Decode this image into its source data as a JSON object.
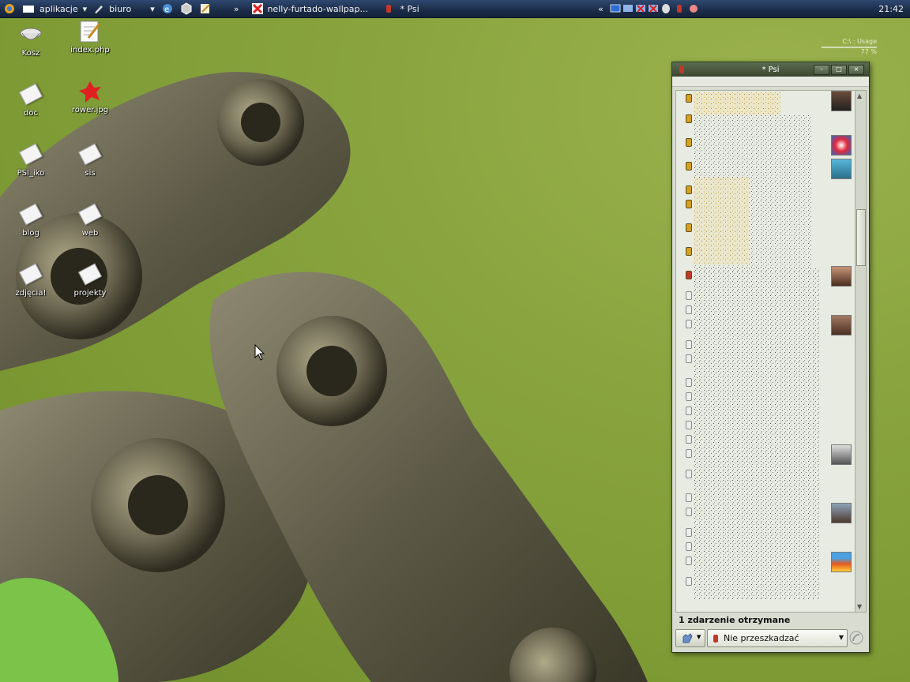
{
  "panel": {
    "menu_apps": "aplikacje",
    "menu_office": "biuro",
    "task_wallpaper": "nelly-furtado-wallpap...",
    "task_psi": "* Psi",
    "clock": "21:42"
  },
  "desktop_icons": [
    {
      "label": "Kosz"
    },
    {
      "label": "index.php"
    },
    {
      "label": "doc"
    },
    {
      "label": "rower.jpg"
    },
    {
      "label": "PSI_iko"
    },
    {
      "label": "sis"
    },
    {
      "label": "blog"
    },
    {
      "label": "web"
    },
    {
      "label": "zdjęcia!"
    },
    {
      "label": "projekty"
    }
  ],
  "sysmon": {
    "title": "C:\\ : Usage",
    "value": "77 %"
  },
  "psi": {
    "title": "* Psi",
    "events_text": "1 zdarzenie otrzymane",
    "status_value": "Nie przeszkadzać"
  },
  "colors": {
    "panel": "#1b2c48",
    "wallpaper_green": "#86a23c",
    "status_dnd": "#c0392b",
    "status_online": "#d6a21e"
  }
}
